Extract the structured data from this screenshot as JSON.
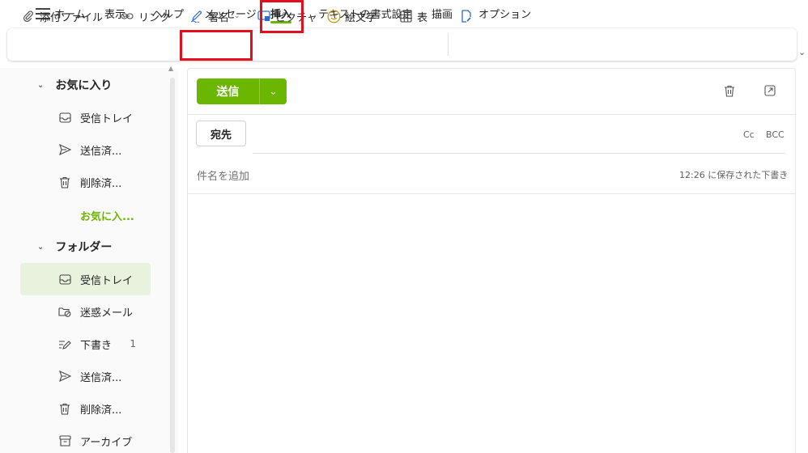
{
  "tabs": [
    "ホーム",
    "表示",
    "ヘルプ",
    "メッセージ",
    "挿入",
    "テキストの書式設定",
    "描画",
    "オプション"
  ],
  "active_tab": "挿入",
  "ribbon": {
    "attach": "添付ファイル",
    "link": "リンク",
    "signature": "署名",
    "picture": "ピクチャ",
    "emoji": "絵文字",
    "table": "表"
  },
  "sidebar": {
    "favorites_header": "お気に入り",
    "favorites": [
      {
        "label": "受信トレイ",
        "icon": "inbox-icon"
      },
      {
        "label": "送信済...",
        "icon": "send-icon"
      },
      {
        "label": "削除済...",
        "icon": "trash-icon"
      },
      {
        "label": "お気に入...",
        "icon": ""
      }
    ],
    "folders_header": "フォルダー",
    "folders": [
      {
        "label": "受信トレイ",
        "icon": "inbox-icon",
        "count": ""
      },
      {
        "label": "迷惑メール",
        "icon": "junk-icon",
        "count": ""
      },
      {
        "label": "下書き",
        "icon": "draft-icon",
        "count": "1"
      },
      {
        "label": "送信済...",
        "icon": "send-icon",
        "count": ""
      },
      {
        "label": "削除済...",
        "icon": "trash-icon",
        "count": ""
      },
      {
        "label": "アーカイブ",
        "icon": "archive-icon",
        "count": ""
      }
    ]
  },
  "compose": {
    "send_label": "送信",
    "to_label": "宛先",
    "cc_label": "Cc",
    "bcc_label": "BCC",
    "subject_placeholder": "件名を追加",
    "saved_status": "12:26 に保存された下書き"
  },
  "colors": {
    "accent": "#6bb700",
    "highlight": "#e0101e",
    "selected_bg": "#e8f2dc"
  }
}
